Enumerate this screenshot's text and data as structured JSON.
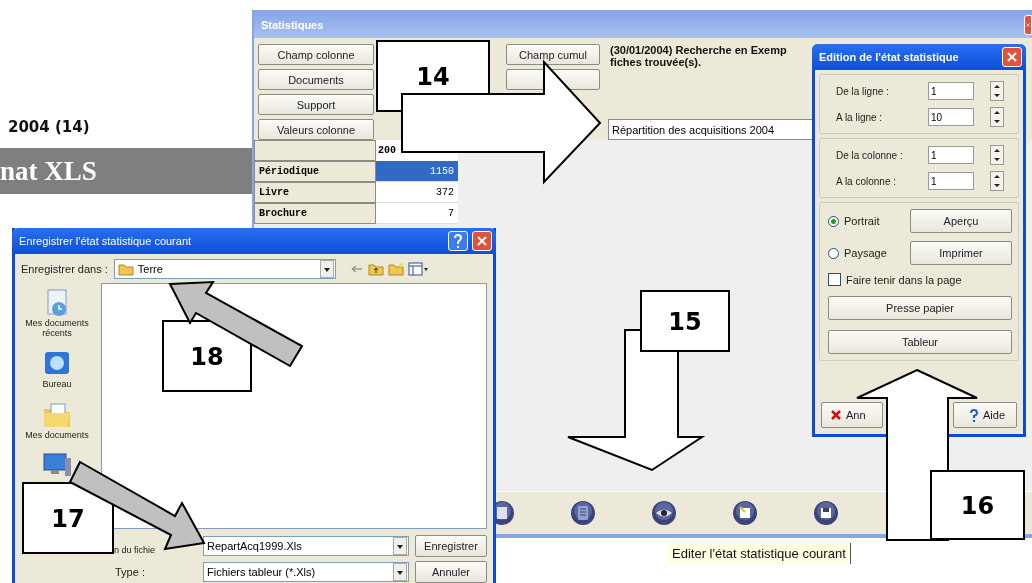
{
  "document": {
    "heading_fragment": "2004 (14)",
    "banner_fragment": "nat XLS"
  },
  "statistics_window": {
    "title": "Statistiques",
    "field_buttons": [
      "Champ colonne",
      "Documents",
      "Support",
      "Valeurs colonne"
    ],
    "cumul_button": "Champ cumul",
    "search_summary": [
      "(30/01/2004) Recherche en  Exemp",
      "fiches trouvée(s)."
    ],
    "title_field": {
      "value": "Répartition des acquisitions 2004"
    },
    "table": {
      "columns": [
        "200"
      ],
      "rows": [
        {
          "label": "Périodique",
          "value": "1150",
          "selected": true
        },
        {
          "label": "Livre",
          "value": "372",
          "selected": false
        },
        {
          "label": "Brochure",
          "value": "7",
          "selected": false
        }
      ]
    },
    "tooltip": "Editer l'état statistique courant"
  },
  "edit_dialog": {
    "title": "Edition de l'état statistique",
    "row_fields": [
      {
        "label": "De la ligne :",
        "value": "1"
      },
      {
        "label": "A la ligne :",
        "value": "10"
      }
    ],
    "column_fields": [
      {
        "label": "De la colonne :",
        "value": "1"
      },
      {
        "label": "A la colonne :",
        "value": "1"
      }
    ],
    "orientations": [
      {
        "label": "Portrait",
        "selected": true,
        "button": "Aperçu"
      },
      {
        "label": "Paysage",
        "selected": false,
        "button": "Imprimer"
      }
    ],
    "fit_page": {
      "label": "Faire tenir dans la page",
      "checked": false
    },
    "export_buttons": [
      "Presse papier",
      "Tableur"
    ],
    "cancel_button": "Ann",
    "help_button": "Aide"
  },
  "save_dialog": {
    "title": "Enregistrer l'état statistique courant",
    "location_label": "Enregistrer dans :",
    "location": "Terre",
    "places": [
      {
        "label": "Mes documents récents"
      },
      {
        "label": "Bureau"
      },
      {
        "label": "Mes documents"
      }
    ],
    "filename_label": "n du fichie",
    "filename": "RepartAcq1999.Xls",
    "type_label": "Type :",
    "type": "Fichiers tableur (*.Xls)",
    "save_button": "Enregistrer",
    "cancel_button": "Annuler"
  },
  "callouts": [
    {
      "label": "14"
    },
    {
      "label": "15"
    },
    {
      "label": "16"
    },
    {
      "label": "17"
    },
    {
      "label": "18"
    }
  ]
}
